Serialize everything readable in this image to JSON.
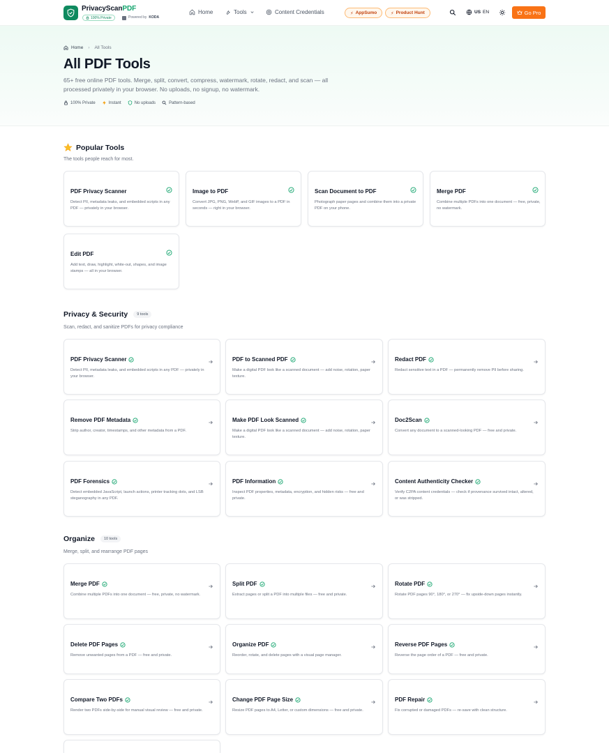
{
  "brand": {
    "name_main": "PrivacyScan",
    "name_accent": "PDF",
    "private_badge": "100% Private",
    "powered_prefix": "Powered by",
    "powered_name": "KODA"
  },
  "nav": {
    "home": "Home",
    "tools": "Tools",
    "content_credentials": "Content Credentials",
    "appsumo": "AppSumo",
    "product_hunt": "Product Hunt",
    "lang_flag": "US",
    "lang_code": "EN",
    "go_pro": "Go Pro"
  },
  "hero": {
    "breadcrumb_home": "Home",
    "breadcrumb_current": "All Tools",
    "title": "All PDF Tools",
    "subtitle": "65+ free online PDF tools. Merge, split, convert, compress, watermark, rotate, redact, and scan — all processed privately in your browser. No uploads, no signup, no watermark.",
    "features": [
      "100% Private",
      "Instant",
      "No uploads",
      "Pattern-based"
    ]
  },
  "popular": {
    "title": "Popular Tools",
    "subtitle": "The tools people reach for most.",
    "cards": [
      {
        "title": "PDF Privacy Scanner",
        "desc": "Detect PII, metadata leaks, and embedded scripts in any PDF — privately in your browser."
      },
      {
        "title": "Image to PDF",
        "desc": "Convert JPG, PNG, WebP, and GIF images to a PDF in seconds — right in your browser."
      },
      {
        "title": "Scan Document to PDF",
        "desc": "Photograph paper pages and combine them into a private PDF on your phone."
      },
      {
        "title": "Merge PDF",
        "desc": "Combine multiple PDFs into one document — free, private, no watermark."
      },
      {
        "title": "Edit PDF",
        "desc": "Add text, draw, highlight, white-out, shapes, and image stamps — all in your browser."
      }
    ]
  },
  "privacy": {
    "title": "Privacy & Security",
    "count": "9 tools",
    "subtitle": "Scan, redact, and sanitize PDFs for privacy compliance",
    "cards": [
      {
        "title": "PDF Privacy Scanner",
        "desc": "Detect PII, metadata leaks, and embedded scripts in any PDF — privately in your browser."
      },
      {
        "title": "PDF to Scanned PDF",
        "desc": "Make a digital PDF look like a scanned document — add noise, rotation, paper texture."
      },
      {
        "title": "Redact PDF",
        "desc": "Redact sensitive text in a PDF — permanently remove PII before sharing."
      },
      {
        "title": "Remove PDF Metadata",
        "desc": "Strip author, creator, timestamps, and other metadata from a PDF."
      },
      {
        "title": "Make PDF Look Scanned",
        "desc": "Make a digital PDF look like a scanned document — add noise, rotation, paper texture."
      },
      {
        "title": "Doc2Scan",
        "desc": "Convert any document to a scanned-looking PDF — free and private."
      },
      {
        "title": "PDF Forensics",
        "desc": "Detect embedded JavaScript, launch actions, printer tracking dots, and LSB steganography in any PDF."
      },
      {
        "title": "PDF Information",
        "desc": "Inspect PDF properties, metadata, encryption, and hidden risks — free and private."
      },
      {
        "title": "Content Authenticity Checker",
        "desc": "Verify C2PA content credentials — check if provenance survived intact, altered, or was stripped."
      }
    ]
  },
  "organize": {
    "title": "Organize",
    "count": "10 tools",
    "subtitle": "Merge, split, and rearrange PDF pages",
    "cards": [
      {
        "title": "Merge PDF",
        "desc": "Combine multiple PDFs into one document — free, private, no watermark."
      },
      {
        "title": "Split PDF",
        "desc": "Extract pages or split a PDF into multiple files — free and private."
      },
      {
        "title": "Rotate PDF",
        "desc": "Rotate PDF pages 90°, 180°, or 270° — fix upside-down pages instantly."
      },
      {
        "title": "Delete PDF Pages",
        "desc": "Remove unwanted pages from a PDF — free and private."
      },
      {
        "title": "Organize PDF",
        "desc": "Reorder, rotate, and delete pages with a visual page manager."
      },
      {
        "title": "Reverse PDF Pages",
        "desc": "Reverse the page order of a PDF — free and private."
      },
      {
        "title": "Compare Two PDFs",
        "desc": "Render two PDFs side-by-side for manual visual review — free and private."
      },
      {
        "title": "Change PDF Page Size",
        "desc": "Resize PDF pages to A4, Letter, or custom dimensions — free and private."
      },
      {
        "title": "PDF Repair",
        "desc": "Fix corrupted or damaged PDFs — re-save with clean structure."
      }
    ]
  }
}
